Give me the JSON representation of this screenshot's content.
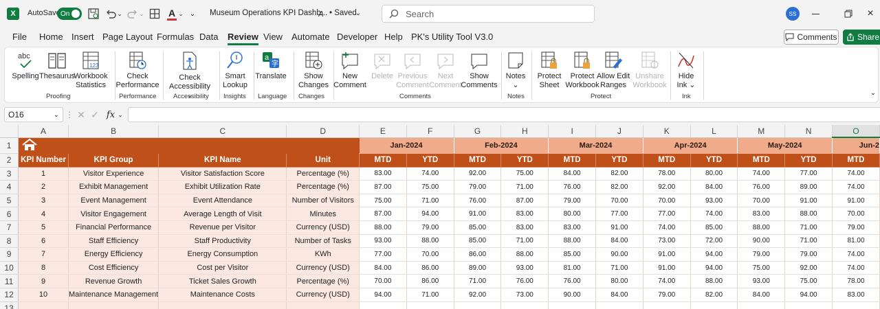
{
  "titlebar": {
    "autosave_label": "AutoSave",
    "toggle_label": "On",
    "filename": "Museum Operations KPI Dashb...",
    "saved": "• Saved",
    "search_placeholder": "Search",
    "user_initials": "SS"
  },
  "menu": [
    "File",
    "Home",
    "Insert",
    "Page Layout",
    "Formulas",
    "Data",
    "Review",
    "View",
    "Automate",
    "Developer",
    "Help",
    "PK's Utility Tool V3.0"
  ],
  "active_menu": "Review",
  "top_buttons": {
    "comments": "Comments",
    "share": "Share"
  },
  "ribbon": {
    "spelling": "Spelling",
    "thesaurus": "Thesaurus",
    "workbook_statistics": [
      "Workbook",
      "Statistics"
    ],
    "check_performance": [
      "Check",
      "Performance"
    ],
    "check_accessibility": [
      "Check",
      "Accessibility ⌄"
    ],
    "smart_lookup": [
      "Smart",
      "Lookup"
    ],
    "translate": "Translate",
    "show_changes": [
      "Show",
      "Changes"
    ],
    "new_comment": [
      "New",
      "Comment"
    ],
    "delete": "Delete",
    "previous_comment": [
      "Previous",
      "Comment"
    ],
    "next_comment": [
      "Next",
      "Comment"
    ],
    "show_comments": [
      "Show",
      "Comments"
    ],
    "notes": "Notes",
    "protect_sheet": [
      "Protect",
      "Sheet"
    ],
    "protect_workbook": [
      "Protect",
      "Workbook"
    ],
    "allow_edit_ranges": [
      "Allow Edit",
      "Ranges"
    ],
    "unshare_workbook": [
      "Unshare",
      "Workbook"
    ],
    "hide_ink": [
      "Hide",
      "Ink ⌄"
    ],
    "groups": {
      "proofing": "Proofing",
      "performance": "Performance",
      "accessibility": "Accessibility",
      "insights": "Insights",
      "language": "Language",
      "changes": "Changes",
      "comments": "Comments",
      "notes": "Notes",
      "protect": "Protect",
      "ink": "Ink"
    }
  },
  "formula_bar": {
    "name_box": "O16",
    "fx": "fx",
    "formula": ""
  },
  "columns": [
    "A",
    "B",
    "C",
    "D",
    "E",
    "F",
    "G",
    "H",
    "I",
    "J",
    "K",
    "L",
    "M",
    "N",
    "O"
  ],
  "selected_column": "O",
  "months": [
    "Jan-2024",
    "Feb-2024",
    "Mar-2024",
    "Apr-2024",
    "May-2024",
    "Jun-2"
  ],
  "headers": {
    "kpi_number": "KPI Number",
    "kpi_group": "KPI Group",
    "kpi_name": "KPI Name",
    "unit": "Unit",
    "mtd": "MTD",
    "ytd": "YTD"
  },
  "rows": [
    {
      "n": "1",
      "group": "Visitor Experience",
      "name": "Visitor Satisfaction Score",
      "unit": "Percentage (%)",
      "vals": [
        "83.00",
        "74.00",
        "92.00",
        "75.00",
        "84.00",
        "82.00",
        "78.00",
        "80.00",
        "74.00",
        "77.00",
        "74.00"
      ]
    },
    {
      "n": "2",
      "group": "Exhibit Management",
      "name": "Exhibit Utilization Rate",
      "unit": "Percentage (%)",
      "vals": [
        "87.00",
        "75.00",
        "79.00",
        "71.00",
        "76.00",
        "82.00",
        "92.00",
        "84.00",
        "76.00",
        "89.00",
        "74.00"
      ]
    },
    {
      "n": "3",
      "group": "Event Management",
      "name": "Event Attendance",
      "unit": "Number of Visitors",
      "vals": [
        "75.00",
        "71.00",
        "76.00",
        "87.00",
        "79.00",
        "70.00",
        "70.00",
        "93.00",
        "70.00",
        "91.00",
        "91.00"
      ]
    },
    {
      "n": "4",
      "group": "Visitor Engagement",
      "name": "Average Length of Visit",
      "unit": "Minutes",
      "vals": [
        "87.00",
        "94.00",
        "91.00",
        "83.00",
        "80.00",
        "77.00",
        "77.00",
        "74.00",
        "83.00",
        "88.00",
        "70.00"
      ]
    },
    {
      "n": "5",
      "group": "Financial Performance",
      "name": "Revenue per Visitor",
      "unit": "Currency (USD)",
      "vals": [
        "88.00",
        "79.00",
        "85.00",
        "83.00",
        "83.00",
        "91.00",
        "74.00",
        "85.00",
        "88.00",
        "71.00",
        "79.00"
      ]
    },
    {
      "n": "6",
      "group": "Staff Efficiency",
      "name": "Staff Productivity",
      "unit": "Number of Tasks",
      "vals": [
        "93.00",
        "88.00",
        "85.00",
        "71.00",
        "88.00",
        "84.00",
        "73.00",
        "72.00",
        "90.00",
        "71.00",
        "81.00"
      ]
    },
    {
      "n": "7",
      "group": "Energy Efficiency",
      "name": "Energy Consumption",
      "unit": "KWh",
      "vals": [
        "77.00",
        "70.00",
        "86.00",
        "88.00",
        "85.00",
        "90.00",
        "91.00",
        "94.00",
        "79.00",
        "79.00",
        "74.00"
      ]
    },
    {
      "n": "8",
      "group": "Cost Efficiency",
      "name": "Cost per Visitor",
      "unit": "Currency (USD)",
      "vals": [
        "84.00",
        "86.00",
        "89.00",
        "93.00",
        "81.00",
        "71.00",
        "91.00",
        "94.00",
        "75.00",
        "92.00",
        "74.00"
      ]
    },
    {
      "n": "9",
      "group": "Revenue Growth",
      "name": "Ticket Sales Growth",
      "unit": "Percentage (%)",
      "vals": [
        "70.00",
        "86.00",
        "71.00",
        "76.00",
        "76.00",
        "80.00",
        "74.00",
        "88.00",
        "93.00",
        "75.00",
        "78.00"
      ]
    },
    {
      "n": "10",
      "group": "Maintenance Management",
      "name": "Maintenance Costs",
      "unit": "Currency (USD)",
      "vals": [
        "94.00",
        "71.00",
        "92.00",
        "73.00",
        "90.00",
        "84.00",
        "79.00",
        "82.00",
        "84.00",
        "94.00",
        "83.00"
      ]
    }
  ],
  "colors": {
    "excel_green": "#107c41",
    "band": "#c0501a",
    "month_band": "#f0ac8a",
    "row_fill": "#fbe9e1"
  }
}
